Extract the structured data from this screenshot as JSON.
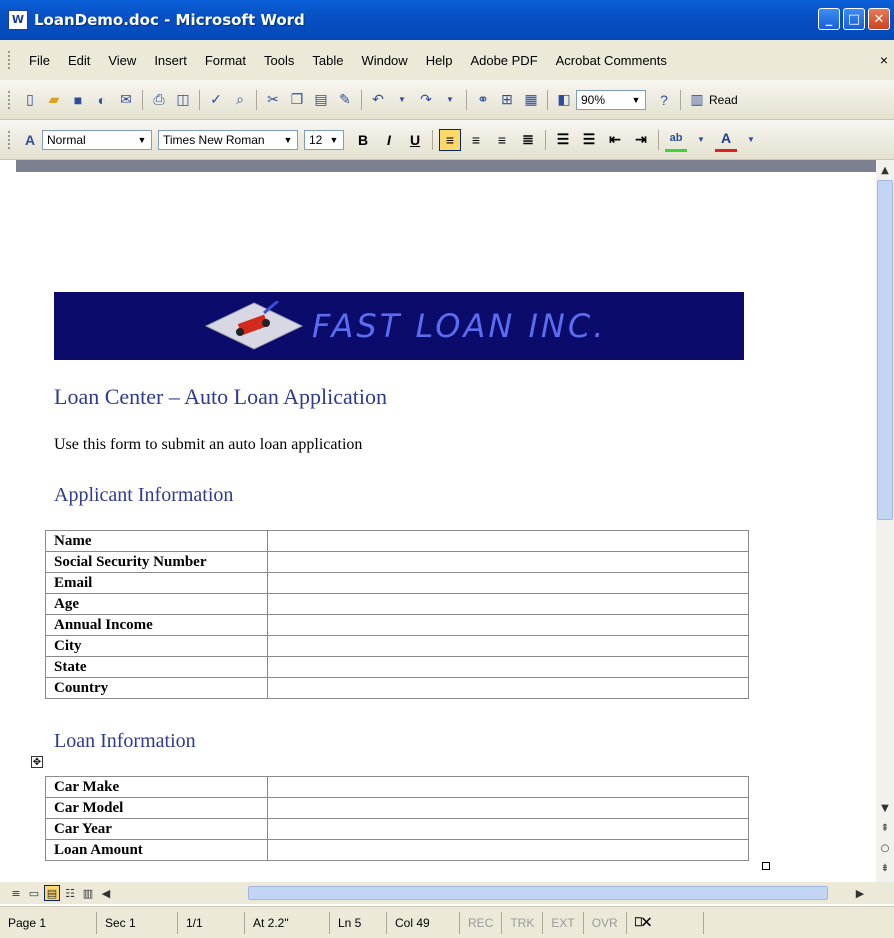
{
  "window": {
    "title": "LoanDemo.doc - Microsoft Word",
    "app_icon": "W",
    "minimize": "_",
    "maximize": "□",
    "close": "✕"
  },
  "menu": {
    "items": [
      "File",
      "Edit",
      "View",
      "Insert",
      "Format",
      "Tools",
      "Table",
      "Window",
      "Help",
      "Adobe PDF",
      "Acrobat Comments"
    ],
    "close": "×"
  },
  "standard_toolbar": {
    "zoom": "90%",
    "read_label": "Read"
  },
  "formatting_toolbar": {
    "style": "Normal",
    "font": "Times New Roman",
    "size": "12",
    "bold": "B",
    "italic": "I",
    "underline": "U",
    "font_color_label": "A"
  },
  "document": {
    "banner_text": "FAST LOAN INC.",
    "heading": "Loan Center – Auto Loan Application",
    "intro": "Use this form to submit an auto loan application",
    "section1_title": "Applicant Information",
    "applicant_fields": [
      "Name",
      "Social Security Number",
      "Email",
      "Age",
      "Annual Income",
      "City",
      "State",
      "Country"
    ],
    "section2_title": "Loan Information",
    "loan_fields": [
      "Car Make",
      "Car Model",
      "Car Year",
      "Loan Amount"
    ]
  },
  "status": {
    "page": "Page 1",
    "sec": "Sec 1",
    "pages": "1/1",
    "at": "At 2.2\"",
    "ln": "Ln 5",
    "col": "Col 49",
    "rec": "REC",
    "trk": "TRK",
    "ext": "EXT",
    "ovr": "OVR"
  },
  "colors": {
    "title_blue": "#0348b8",
    "heading_blue": "#2e3b8e",
    "banner_navy": "#0a0b6a"
  }
}
